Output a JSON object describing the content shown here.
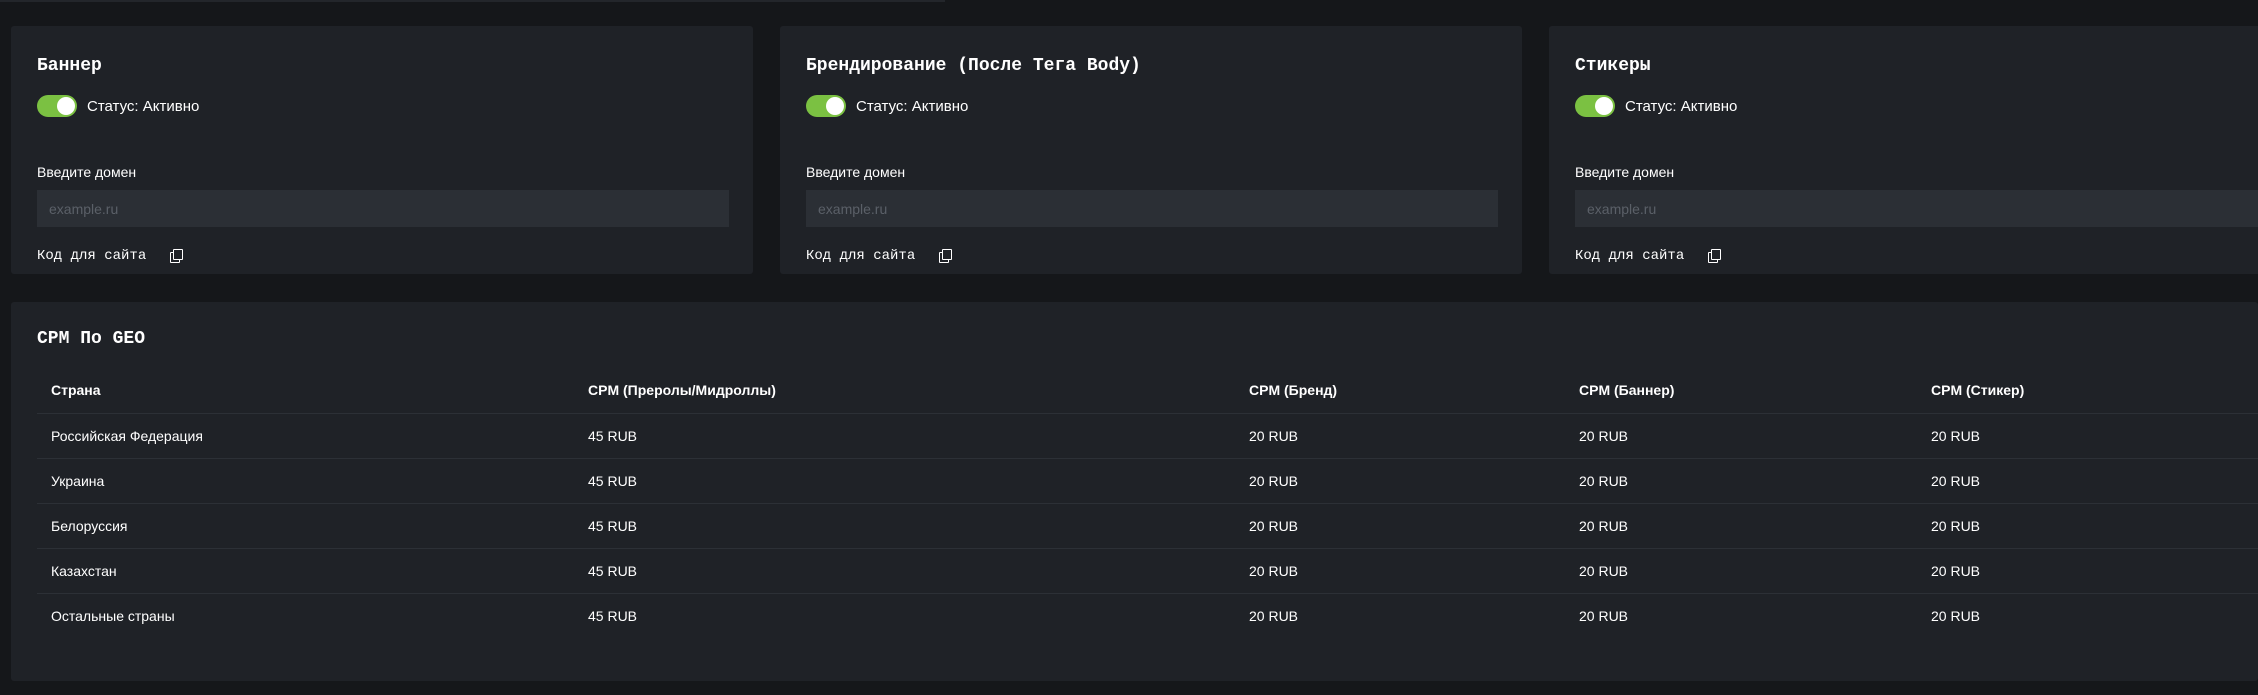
{
  "cards": [
    {
      "title": "Баннер",
      "status": "Статус: Активно",
      "domain_label": "Введите домен",
      "domain_placeholder": "example.ru",
      "code_label": "Код для сайта"
    },
    {
      "title": "Брендирование (После Тега Body)",
      "status": "Статус: Активно",
      "domain_label": "Введите домен",
      "domain_placeholder": "example.ru",
      "code_label": "Код для сайта"
    },
    {
      "title": "Стикеры",
      "status": "Статус: Активно",
      "domain_label": "Введите домен",
      "domain_placeholder": "example.ru",
      "code_label": "Код для сайта"
    }
  ],
  "cpm_table": {
    "title": "CPM По GEO",
    "headers": [
      "Страна",
      "CPM (Преролы/Мидроллы)",
      "CPM (Бренд)",
      "CPM (Баннер)",
      "CPM (Стикер)"
    ],
    "rows": [
      [
        "Российская Федерация",
        "45 RUB",
        "20 RUB",
        "20 RUB",
        "20 RUB"
      ],
      [
        "Украина",
        "45 RUB",
        "20 RUB",
        "20 RUB",
        "20 RUB"
      ],
      [
        "Белоруссия",
        "45 RUB",
        "20 RUB",
        "20 RUB",
        "20 RUB"
      ],
      [
        "Казахстан",
        "45 RUB",
        "20 RUB",
        "20 RUB",
        "20 RUB"
      ],
      [
        "Остальные страны",
        "45 RUB",
        "20 RUB",
        "20 RUB",
        "20 RUB"
      ]
    ]
  },
  "colors": {
    "background": "#15171a",
    "panel": "#1f2227",
    "input": "#2b2f35",
    "toggle_on": "#7bc142"
  }
}
